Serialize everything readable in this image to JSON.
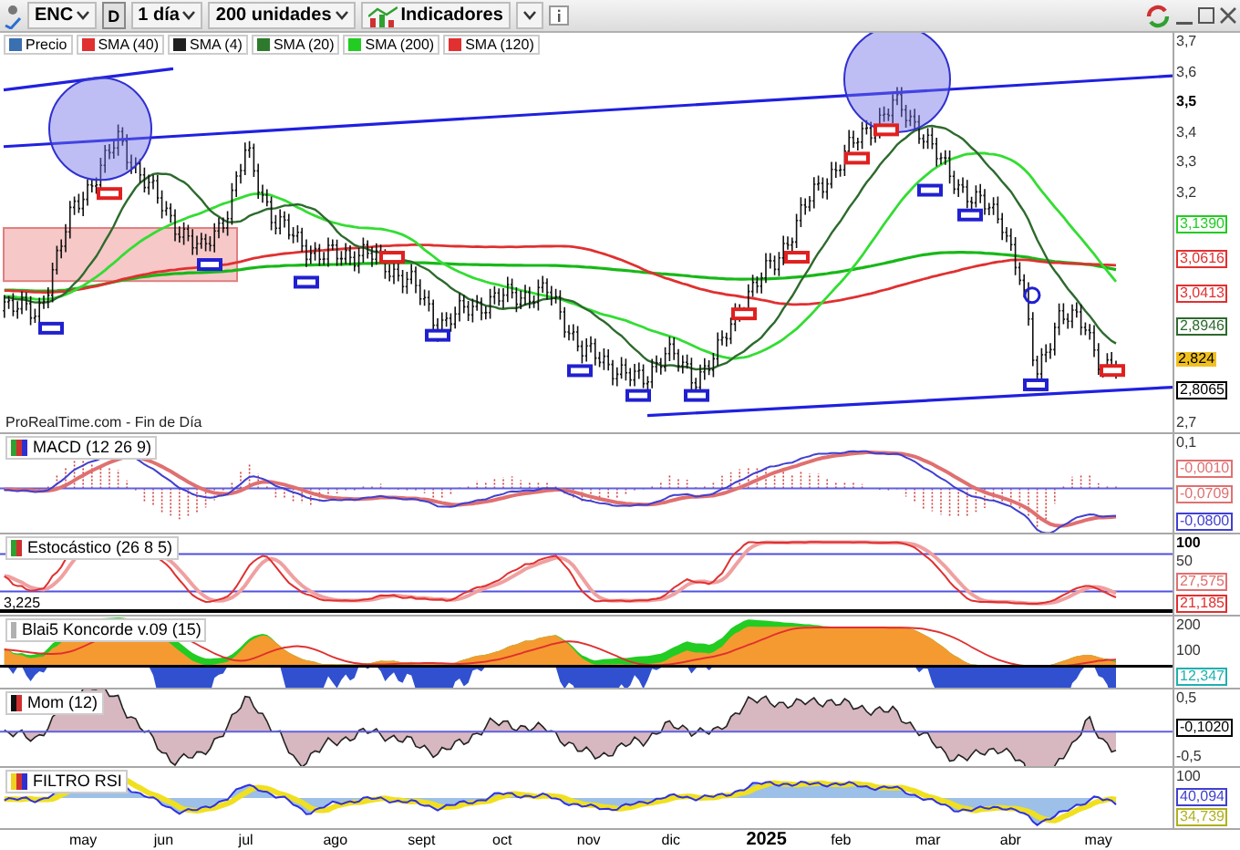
{
  "toolbar": {
    "ticker": "ENC",
    "period_badge": "D",
    "interval": "1 día",
    "units": "200 unidades",
    "indicators": "Indicadores"
  },
  "main_panel": {
    "legend": [
      {
        "label": "Precio",
        "color": "#3a6fb0"
      },
      {
        "label": "SMA (40)",
        "color": "#e03030"
      },
      {
        "label": "SMA (4)",
        "color": "#202020"
      },
      {
        "label": "SMA (20)",
        "color": "#2d7a2d"
      },
      {
        "label": "SMA (200)",
        "color": "#22cc22"
      },
      {
        "label": "SMA (120)",
        "color": "#e03030"
      }
    ],
    "source": "ProRealTime.com - Fin de Día",
    "axis_labels": [
      {
        "text": "3,7",
        "kind": "tick"
      },
      {
        "text": "3,6",
        "kind": "tick"
      },
      {
        "text": "3,5",
        "kind": "major"
      },
      {
        "text": "3,4",
        "kind": "tick"
      },
      {
        "text": "3,3",
        "kind": "tick"
      },
      {
        "text": "3,2",
        "kind": "tick"
      },
      {
        "text": "3,1390",
        "kind": "readout",
        "color": "#22cc22"
      },
      {
        "text": "3,0616",
        "kind": "readout",
        "color": "#e03030"
      },
      {
        "text": "3,0413",
        "kind": "readout",
        "color": "#e03030"
      },
      {
        "text": "2,8946",
        "kind": "readout",
        "color": "#2d6a2d"
      },
      {
        "text": "2,824",
        "kind": "highlight",
        "color": "#f0c020"
      },
      {
        "text": "2,8065",
        "kind": "readout",
        "color": "#000000"
      },
      {
        "text": "2,7",
        "kind": "tick"
      }
    ]
  },
  "panels": [
    {
      "kind": "macd",
      "title": "MACD (12 26 9)",
      "axis_labels": [
        {
          "text": "0,1",
          "kind": "tick"
        },
        {
          "text": "-0,0010",
          "kind": "readout",
          "color": "#e07070"
        },
        {
          "text": "-0,0709",
          "kind": "readout",
          "color": "#e07070"
        },
        {
          "text": "-0,0800",
          "kind": "readout",
          "color": "#4040d0"
        }
      ]
    },
    {
      "kind": "stochastic",
      "title": "Estocástico (26 8 5)",
      "left_note": "3,225",
      "axis_labels": [
        {
          "text": "100",
          "kind": "major"
        },
        {
          "text": "50",
          "kind": "tick"
        },
        {
          "text": "27,575",
          "kind": "readout",
          "color": "#e07070"
        },
        {
          "text": "21,185",
          "kind": "readout",
          "color": "#e03030"
        }
      ]
    },
    {
      "kind": "koncorde",
      "title": "Blai5 Koncorde v.09 (15)",
      "axis_labels": [
        {
          "text": "200",
          "kind": "tick"
        },
        {
          "text": "100",
          "kind": "tick"
        },
        {
          "text": "12,347",
          "kind": "readout",
          "color": "#20b0b0"
        }
      ]
    },
    {
      "kind": "momentum",
      "title": "Mom (12)",
      "axis_labels": [
        {
          "text": "0,5",
          "kind": "tick"
        },
        {
          "text": "-0,1020",
          "kind": "readout",
          "color": "#000000"
        },
        {
          "text": "-0,5",
          "kind": "tick"
        }
      ]
    },
    {
      "kind": "rsi_filter",
      "title": "FILTRO RSI",
      "axis_labels": [
        {
          "text": "100",
          "kind": "tick"
        },
        {
          "text": "40,094",
          "kind": "readout",
          "color": "#4040d0"
        },
        {
          "text": "34,739",
          "kind": "readout",
          "color": "#b0b020"
        }
      ]
    }
  ],
  "x_axis": [
    {
      "label": "may",
      "kind": "month"
    },
    {
      "label": "jun",
      "kind": "month"
    },
    {
      "label": "jul",
      "kind": "month"
    },
    {
      "label": "ago",
      "kind": "month"
    },
    {
      "label": "sept",
      "kind": "month"
    },
    {
      "label": "oct",
      "kind": "month"
    },
    {
      "label": "nov",
      "kind": "month"
    },
    {
      "label": "dic",
      "kind": "month"
    },
    {
      "label": "2025",
      "kind": "year"
    },
    {
      "label": "feb",
      "kind": "month"
    },
    {
      "label": "mar",
      "kind": "month"
    },
    {
      "label": "abr",
      "kind": "month"
    },
    {
      "label": "may",
      "kind": "month"
    }
  ]
}
